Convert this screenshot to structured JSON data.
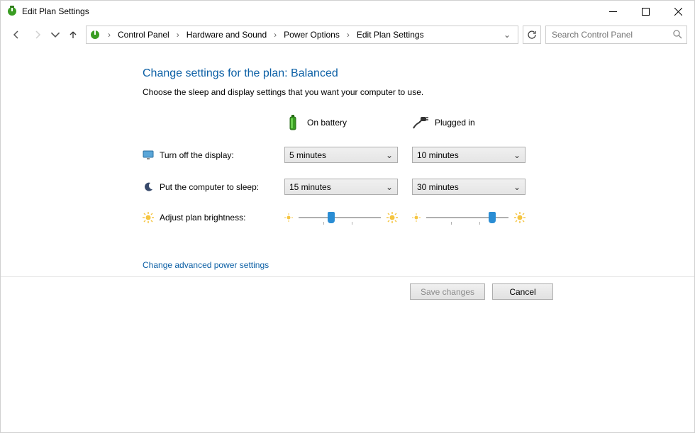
{
  "window": {
    "title": "Edit Plan Settings"
  },
  "breadcrumb": {
    "root": "Control Panel",
    "level1": "Hardware and Sound",
    "level2": "Power Options",
    "level3": "Edit Plan Settings"
  },
  "search": {
    "placeholder": "Search Control Panel"
  },
  "content": {
    "heading": "Change settings for the plan: Balanced",
    "subheading": "Choose the sleep and display settings that you want your computer to use.",
    "col_battery": "On battery",
    "col_plugged": "Plugged in",
    "row_display": "Turn off the display:",
    "row_sleep": "Put the computer to sleep:",
    "row_brightness": "Adjust plan brightness:",
    "display_battery_value": "5 minutes",
    "display_plugged_value": "10 minutes",
    "sleep_battery_value": "15 minutes",
    "sleep_plugged_value": "30 minutes",
    "brightness_battery_pct": 40,
    "brightness_plugged_pct": 80,
    "advanced_link": "Change advanced power settings"
  },
  "footer": {
    "save": "Save changes",
    "cancel": "Cancel"
  }
}
